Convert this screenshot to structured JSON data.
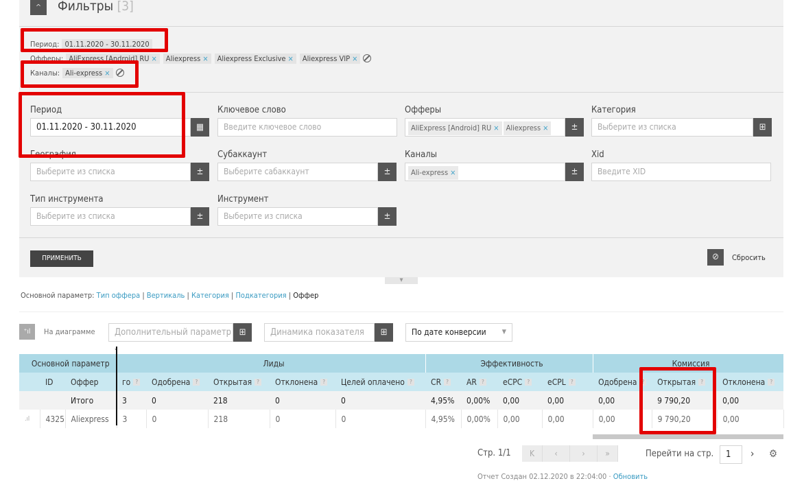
{
  "header": {
    "title": "Фильтры",
    "count": "[3]"
  },
  "summary": {
    "period_label": "Период:",
    "period_value": "01.11.2020 - 30.11.2020",
    "offers_label": "Офферы:",
    "offers": [
      "AliExpress [Android] RU",
      "Aliexpress",
      "Aliexpress Exclusive",
      "Aliexpress VIP"
    ],
    "channels_label": "Каналы:",
    "channels": [
      "Ali-express"
    ]
  },
  "form": {
    "period": {
      "label": "Период",
      "value": "01.11.2020 - 30.11.2020"
    },
    "keyword": {
      "label": "Ключевое слово",
      "placeholder": "Введите ключевое слово"
    },
    "offers": {
      "label": "Офферы",
      "tags": [
        "AliExpress [Android] RU",
        "Aliexpress"
      ]
    },
    "category": {
      "label": "Категория",
      "placeholder": "Выберите из списка"
    },
    "geo": {
      "label": "География",
      "placeholder": "Выберите из списка"
    },
    "subaccount": {
      "label": "Субаккаунт",
      "placeholder": "Выберите сабаккаунт"
    },
    "channels": {
      "label": "Каналы",
      "tags": [
        "Ali-express"
      ]
    },
    "xid": {
      "label": "Xid",
      "placeholder": "Введите XID"
    },
    "tool_type": {
      "label": "Тип инструмента",
      "placeholder": "Выберите из списка"
    },
    "tool": {
      "label": "Инструмент",
      "placeholder": "Выберите из списка"
    },
    "apply": "ПРИМЕНИТЬ",
    "reset": "Сбросить"
  },
  "params": {
    "label": "Основной параметр:",
    "links": [
      "Тип оффера",
      "Вертикаль",
      "Категория",
      "Подкатегория"
    ],
    "current": "Оффер"
  },
  "chart_controls": {
    "on_chart": "На диаграмме",
    "extra_param": "Дополнительный параметр",
    "dynamics": "Динамика показателя",
    "date_mode": "По дате конверсии"
  },
  "table": {
    "groups": [
      {
        "label": "Основной параметр",
        "span": 3
      },
      {
        "label": "Лиды",
        "span": 5
      },
      {
        "label": "Эффективность",
        "span": 4
      },
      {
        "label": "Комиссия",
        "span": 3
      }
    ],
    "columns": [
      {
        "label": "",
        "q": false
      },
      {
        "label": "ID",
        "q": false
      },
      {
        "label": "Оффер",
        "q": false
      },
      {
        "label": "го",
        "q": true
      },
      {
        "label": "Одобрена",
        "q": true
      },
      {
        "label": "Открытая",
        "q": true
      },
      {
        "label": "Отклонена",
        "q": true
      },
      {
        "label": "Целей оплачено",
        "q": true
      },
      {
        "label": "CR",
        "q": true
      },
      {
        "label": "AR",
        "q": true
      },
      {
        "label": "eCPC",
        "q": true
      },
      {
        "label": "eCPL",
        "q": true
      },
      {
        "label": "Одобрена",
        "q": true
      },
      {
        "label": "Открытая",
        "q": true
      },
      {
        "label": "Отклонена",
        "q": true
      }
    ],
    "total": [
      "",
      "",
      "Итого",
      "3",
      "0",
      "218",
      "0",
      "0",
      "4,95%",
      "0,00%",
      "0,00",
      "0,00",
      "0,00",
      "9 790,20",
      "0,00"
    ],
    "rows": [
      [
        "",
        "4325",
        "Aliexpress",
        "3",
        "0",
        "218",
        "0",
        "0",
        "4,95%",
        "0,00%",
        "0,00",
        "0,00",
        "0,00",
        "9 790,20",
        "0,00"
      ]
    ]
  },
  "pagination": {
    "page": "Стр. 1/1",
    "goto": "Перейти на стр.",
    "page_input": "1"
  },
  "footer": {
    "created": "Отчет Создан 02.12.2020 в 22:04:00",
    "refresh": "Обновить"
  }
}
